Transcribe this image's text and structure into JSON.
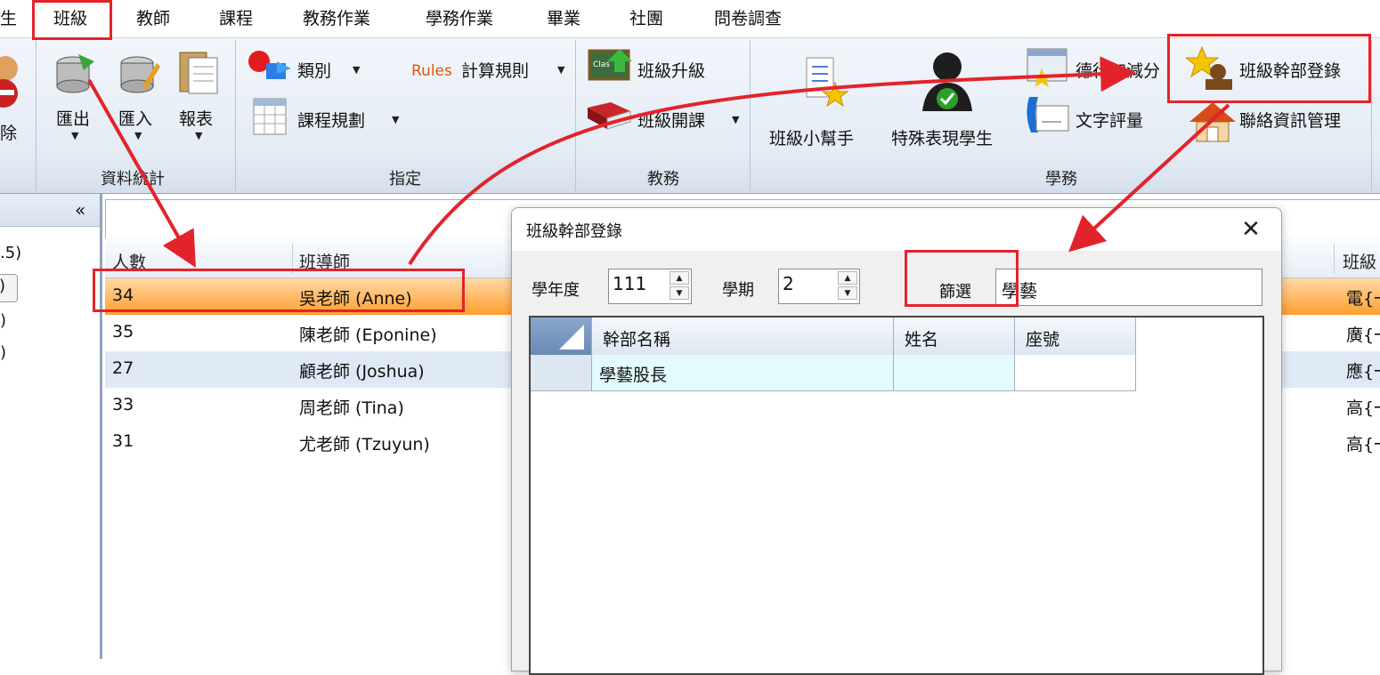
{
  "menu": {
    "partial": "生",
    "items": [
      "班級",
      "教師",
      "課程",
      "教務作業",
      "學務作業",
      "畢業",
      "社團",
      "問卷調查"
    ]
  },
  "ribbon": {
    "partial_delete": "除",
    "export": "匯出",
    "import": "匯入",
    "report": "報表",
    "group_data": "資料統計",
    "category": "類別",
    "rules_icon_text": "Rules",
    "calc_rules": "計算規則",
    "course_plan": "課程規劃",
    "group_assign": "指定",
    "class_icon_text": "Clas",
    "promote": "班級升級",
    "open_course": "班級開課",
    "group_academic": "教務",
    "class_helper": "班級小幫手",
    "special_students": "特殊表現學生",
    "merit": "德行加減分",
    "text_eval": "文字評量",
    "cadre_reg": "班級幹部登錄",
    "contact_mgmt": "聯絡資訊管理",
    "group_student_affairs": "學務"
  },
  "left_pane": {
    "collapse": "«",
    "lines": [
      ".5)",
      ")",
      ")",
      ")"
    ]
  },
  "grid": {
    "headers": [
      "人數",
      "班導師",
      "班級"
    ],
    "rows": [
      {
        "count": "34",
        "teacher": "吳老師 (Anne)",
        "right": "電{一"
      },
      {
        "count": "35",
        "teacher": "陳老師 (Eponine)",
        "right": "廣{一"
      },
      {
        "count": "27",
        "teacher": "顧老師 (Joshua)",
        "right": "應{一"
      },
      {
        "count": "33",
        "teacher": "周老師 (Tina)",
        "right": "高{一"
      },
      {
        "count": "31",
        "teacher": "尤老師 (Tzuyun)",
        "right": "高{一"
      }
    ]
  },
  "dialog": {
    "title": "班級幹部登錄",
    "close": "✕",
    "school_year_label": "學年度",
    "school_year": "111",
    "semester_label": "學期",
    "semester": "2",
    "filter_label": "篩選",
    "filter_value": "學藝",
    "table_headers": [
      "幹部名稱",
      "姓名",
      "座號"
    ],
    "rows": [
      {
        "cadre": "學藝股長",
        "name": "",
        "seat": ""
      }
    ]
  },
  "colors": {
    "highlight": "#e3232b",
    "selected_row": "#ffb65e",
    "alt_row": "#dfe9f6"
  }
}
